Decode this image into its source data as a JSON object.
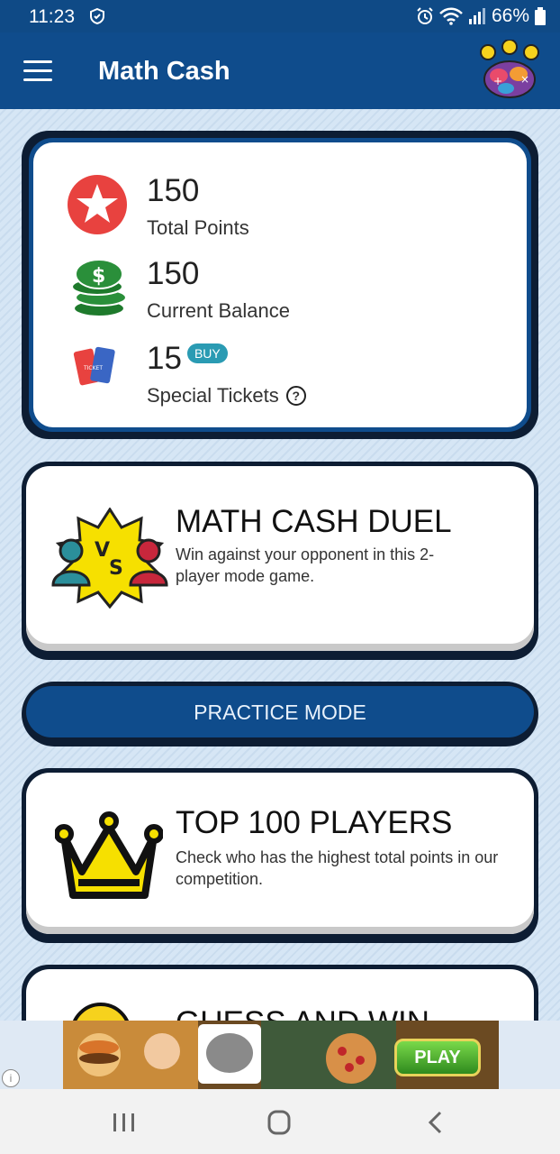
{
  "status_bar": {
    "time": "11:23",
    "battery": "66%"
  },
  "app": {
    "title": "Math Cash"
  },
  "stats": {
    "total_points": {
      "value": "150",
      "label": "Total Points"
    },
    "balance": {
      "value": "150",
      "label": "Current Balance"
    },
    "tickets": {
      "value": "15",
      "label": "Special Tickets",
      "buy_label": "BUY"
    }
  },
  "duel": {
    "title": "MATH CASH DUEL",
    "description": "Win against your opponent in this 2-player mode game."
  },
  "practice": {
    "label": "PRACTICE MODE"
  },
  "top_players": {
    "title": "TOP 100 PLAYERS",
    "description": "Check who has the highest total points in our competition."
  },
  "guess": {
    "title": "GUESS AND WIN"
  },
  "ad": {
    "play_label": "PLAY"
  },
  "colors": {
    "primary": "#0f4c8c",
    "dark_border": "#0d1d33",
    "badge": "#2a9bb3",
    "crown": "#f6e000"
  }
}
